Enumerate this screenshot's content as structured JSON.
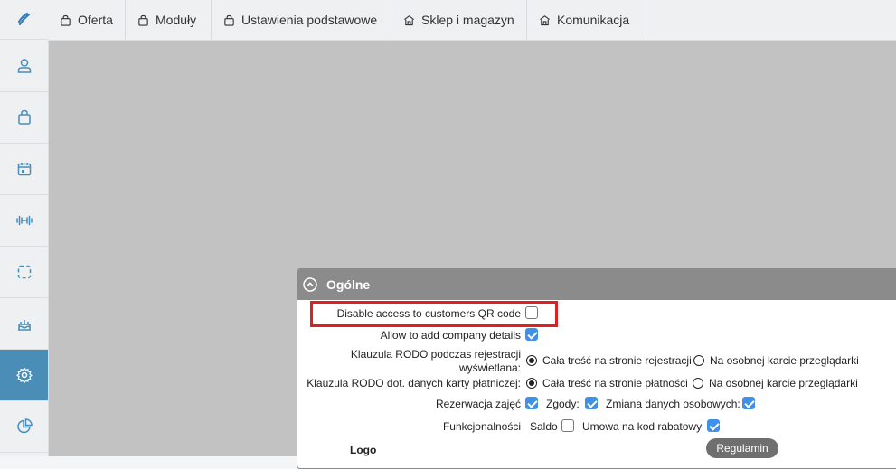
{
  "nav_tabs": [
    {
      "label": "Oferta",
      "icon": "bag-icon"
    },
    {
      "label": "Moduły",
      "icon": "bag-icon"
    },
    {
      "label": "Ustawienia podstawowe",
      "icon": "bag-icon"
    },
    {
      "label": "Sklep i magazyn",
      "icon": "store-icon"
    },
    {
      "label": "Komunikacja",
      "icon": "store-icon"
    }
  ],
  "sidebar": {
    "items": [
      "logo-icon",
      "user-icon",
      "bag-icon",
      "calendar-icon",
      "dumbbell-icon",
      "frame-icon",
      "cake-icon",
      "gear-icon",
      "pie-chart-icon"
    ],
    "active_item": "gear-icon",
    "active_color": "#4a8db7"
  },
  "panel": {
    "title": "Ogólne",
    "rows": {
      "disable_qr": {
        "label": "Disable access to customers QR code",
        "checked": false
      },
      "company_details": {
        "label": "Allow to add company details",
        "checked": true
      },
      "rodo_registration": {
        "label_line1": "Klauzula RODO podczas rejestracji",
        "label_line2": "wyświetlana:",
        "option1": "Cała treść na stronie rejestracji",
        "option2": "Na osobnej karcie przeglądarki",
        "selected": 1
      },
      "rodo_payment": {
        "label": "Klauzula RODO dot. danych karty płatniczej:",
        "option1": "Cała treść na stronie płatności",
        "option2": "Na osobnej karcie przeglądarki",
        "selected": 1
      },
      "reservations": {
        "label": "Rezerwacja zajęć",
        "consents_label": "Zgody:",
        "personal_data_label": "Zmiana danych osobowych:"
      },
      "functions": {
        "label": "Funkcjonalności",
        "balance_label": "Saldo",
        "discount_label": "Umowa na kod rabatowy"
      }
    },
    "logo_label": "Logo",
    "regulations_button": "Regulamin"
  },
  "colors": {
    "highlight": "#e02020",
    "checkbox": "#3f90e8",
    "header": "#8b8b8b"
  }
}
